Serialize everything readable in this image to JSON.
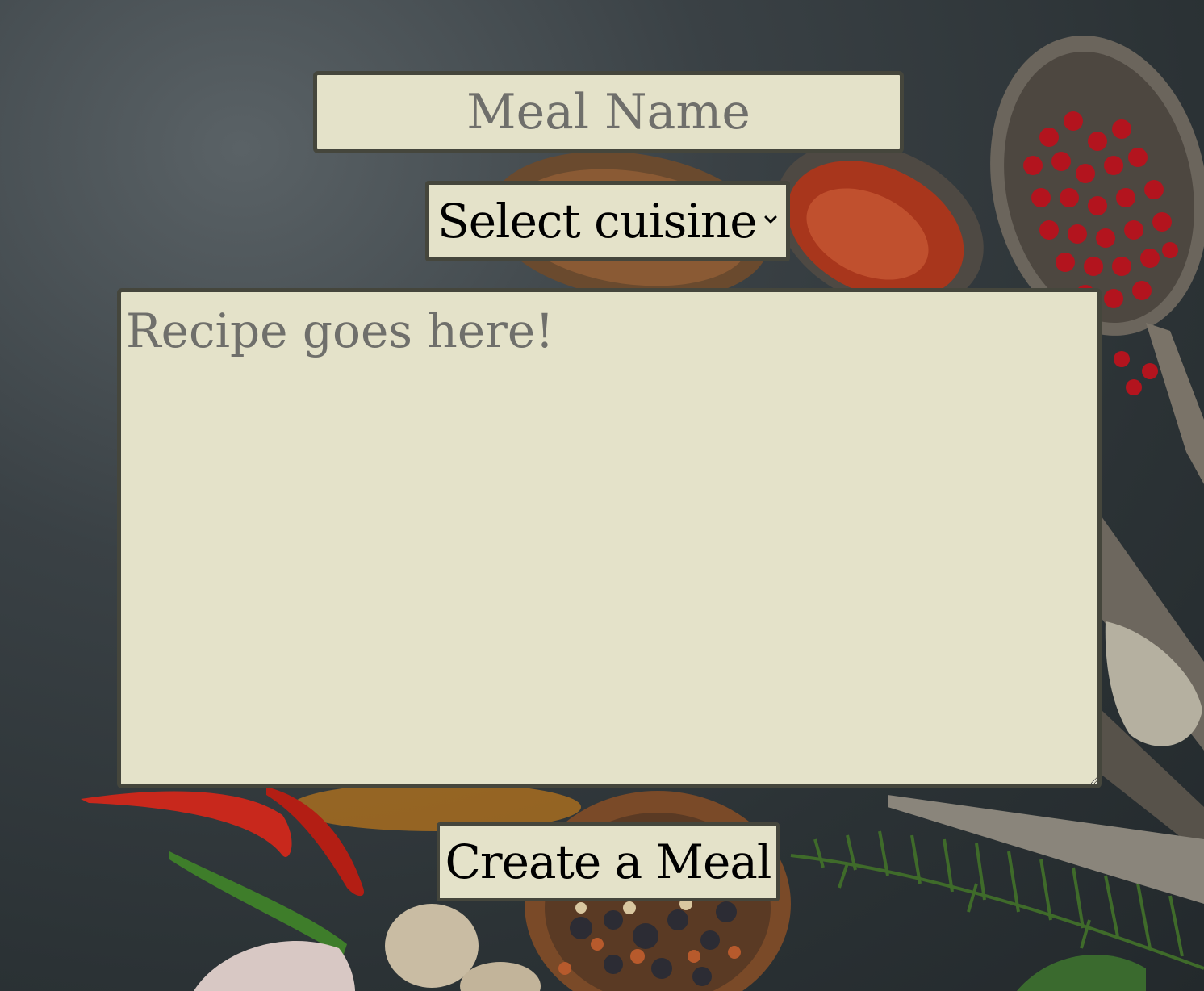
{
  "form": {
    "meal_name": {
      "placeholder": "Meal Name",
      "value": ""
    },
    "cuisine_select": {
      "selected": "Select cuisine",
      "icon": "chevron-down-icon"
    },
    "recipe": {
      "placeholder": "Recipe goes here!",
      "value": ""
    },
    "submit_label": "Create a Meal"
  },
  "colors": {
    "field_background": "#e4e2c9",
    "field_border": "#45463c",
    "placeholder_text": "#6f6f6b",
    "page_background": "#2b3235"
  }
}
